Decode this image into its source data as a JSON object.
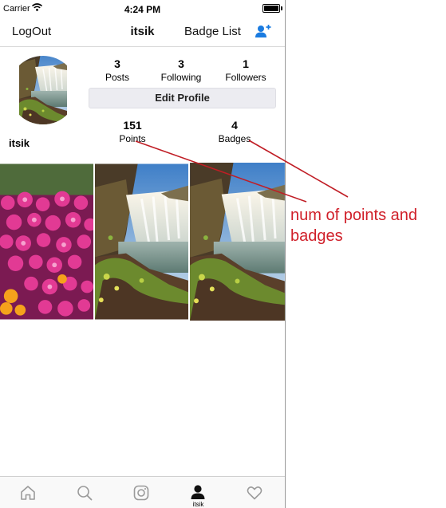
{
  "status_bar": {
    "carrier": "Carrier",
    "time": "4:24 PM"
  },
  "navbar": {
    "logout_label": "LogOut",
    "title": "itsik",
    "badge_list_label": "Badge List",
    "add_user_icon": "add-user-icon"
  },
  "profile": {
    "username": "itsik",
    "stats": [
      {
        "value": "3",
        "label": "Posts"
      },
      {
        "value": "3",
        "label": "Following"
      },
      {
        "value": "1",
        "label": "Followers"
      }
    ],
    "edit_profile_label": "Edit Profile",
    "points": {
      "value": "151",
      "label": "Points"
    },
    "badges": {
      "value": "4",
      "label": "Badges"
    }
  },
  "photos": [
    "flowers-photo",
    "waterfall-photo",
    "waterfall-photo"
  ],
  "tabbar": {
    "tabs": [
      {
        "icon": "home-icon",
        "label": ""
      },
      {
        "icon": "search-icon",
        "label": ""
      },
      {
        "icon": "instagram-icon",
        "label": ""
      },
      {
        "icon": "profile-icon",
        "label": "itsik"
      },
      {
        "icon": "heart-icon",
        "label": ""
      }
    ]
  },
  "annotation": {
    "text": "num of points and badges",
    "color": "#d0202a"
  }
}
